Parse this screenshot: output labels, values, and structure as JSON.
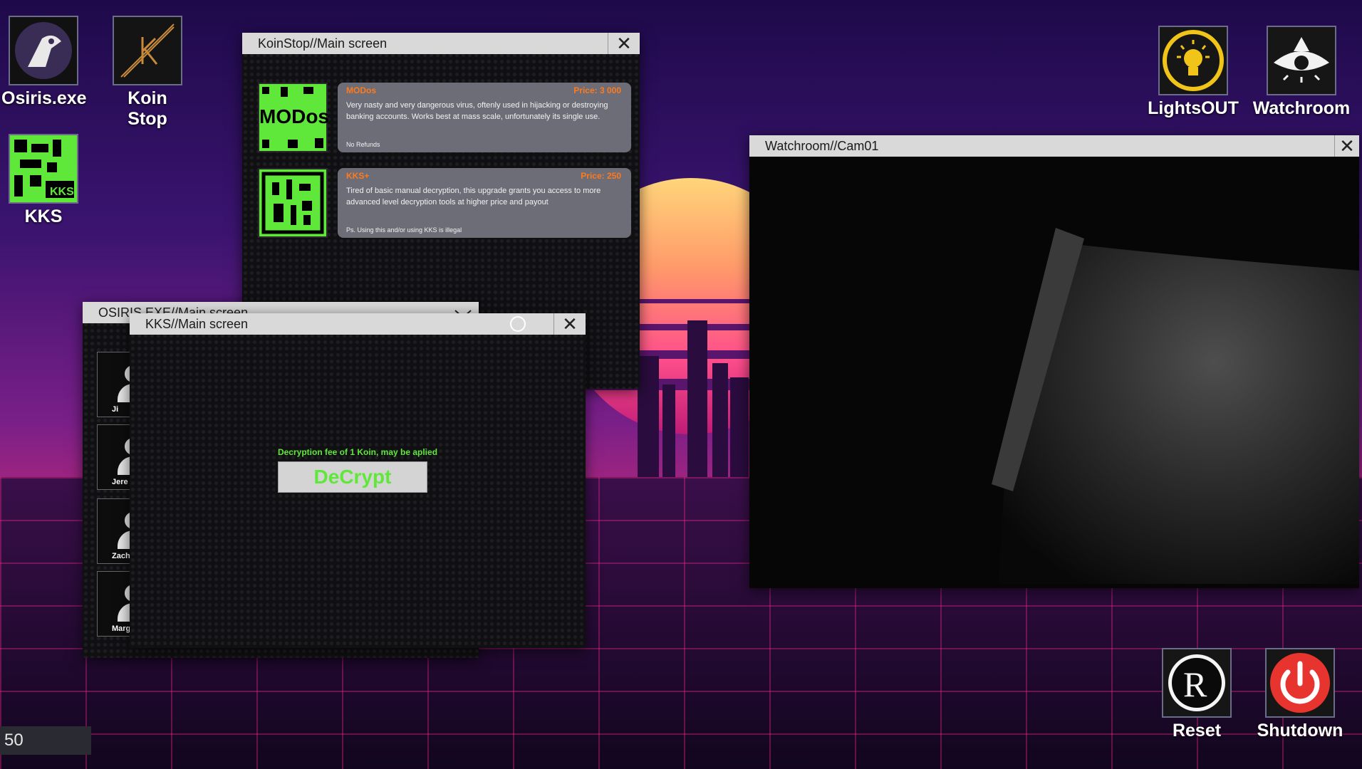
{
  "desktop_icons": [
    {
      "label": "Osiris.exe",
      "icon": "bird-icon"
    },
    {
      "label": "Koin Stop",
      "icon": "k-coin-icon"
    },
    {
      "label": "KKS",
      "icon": "qr-kks-icon"
    },
    {
      "label": "LightsOUT",
      "icon": "lightbulb-icon"
    },
    {
      "label": "Watchroom",
      "icon": "eye-icon"
    },
    {
      "label": "Reset",
      "icon": "reset-icon"
    },
    {
      "label": "Shutdown",
      "icon": "power-icon"
    }
  ],
  "koinstop": {
    "title": "KoinStop//Main screen",
    "close": "✕",
    "items": [
      {
        "thumb_text": "MODos",
        "name": "MODos",
        "price": "Price: 3 000",
        "desc": "Very nasty and very dangerous virus, oftenly used in hijacking or destroying banking accounts. Works best at mass scale, unfortunately its single use.",
        "note": "No Refunds"
      },
      {
        "thumb_text": "",
        "name": "KKS+",
        "price": "Price: 250",
        "desc": "Tired of basic manual decryption, this upgrade grants you access to more advanced level decryption tools at higher price and payout",
        "note": "Ps. Using this and/or using KKS is illegal"
      }
    ]
  },
  "osiris": {
    "title": "OSIRIS.EXE//Main screen",
    "contacts": [
      "Ji",
      "Jere",
      "Zach I",
      "Margaret"
    ]
  },
  "kks": {
    "title": "KKS//Main screen",
    "close": "✕",
    "fee_text": "Decryption fee of 1 Koin, may be aplied",
    "decrypt_label": "DeCrypt"
  },
  "watchroom": {
    "title": "Watchroom//Cam01",
    "close": "✕"
  },
  "counter": "50",
  "colors": {
    "accent_green": "#5fe83a",
    "price_orange": "#ff7a1c",
    "titlebar": "#d9d9d9",
    "shutdown_red": "#e8342e",
    "bulb_yellow": "#f0c419"
  }
}
